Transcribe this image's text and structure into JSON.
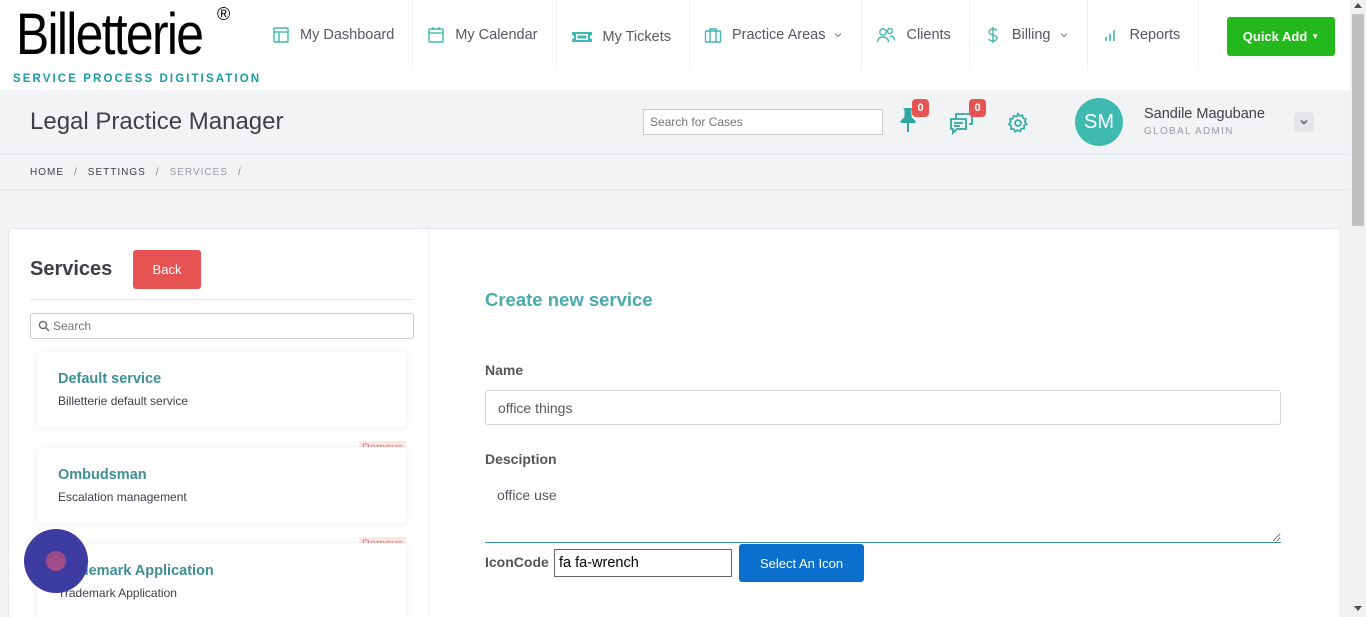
{
  "logo": {
    "main": "Billetterie",
    "reg": "®",
    "sub": "SERVICE PROCESS DIGITISATION"
  },
  "nav": {
    "items": [
      {
        "label": "My Dashboard",
        "icon": "dashboard-icon"
      },
      {
        "label": "My Calendar",
        "icon": "calendar-icon"
      },
      {
        "label": "My Tickets",
        "icon": "ticket-icon"
      },
      {
        "label": "Practice Areas",
        "icon": "briefcase-icon",
        "dropdown": true
      },
      {
        "label": "Clients",
        "icon": "users-icon"
      },
      {
        "label": "Billing",
        "icon": "dollar-icon",
        "dropdown": true
      },
      {
        "label": "Reports",
        "icon": "bar-chart-icon"
      }
    ],
    "quick_add": "Quick Add"
  },
  "header": {
    "title": "Legal Practice Manager",
    "search_placeholder": "Search for Cases",
    "pin_count": "0",
    "chat_count": "0",
    "user": {
      "initials": "SM",
      "name": "Sandile Magubane",
      "role": "GLOBAL ADMIN"
    }
  },
  "breadcrumb": [
    "HOME",
    "SETTINGS",
    "SERVICES"
  ],
  "sidebar": {
    "title": "Services",
    "back_label": "Back",
    "search_placeholder": "Search",
    "remove_label": "Remove",
    "services": [
      {
        "name": "Default service",
        "description": "Billetterie default service"
      },
      {
        "name": "Ombudsman",
        "description": "Escalation management"
      },
      {
        "name": "Trademark Application",
        "description": "Trademark Application"
      }
    ]
  },
  "form": {
    "title": "Create new service",
    "name_label": "Name",
    "name_value": "office things",
    "description_label": "Desciption",
    "description_value": "office use",
    "iconcode_label": "IconCode",
    "iconcode_value": "fa fa-wrench",
    "select_icon_label": "Select An Icon"
  },
  "colors": {
    "accent": "#49aab0",
    "quick_add": "#23b91c",
    "danger": "#e55353",
    "primary": "#0b6fce",
    "avatar": "#3fbab1"
  }
}
